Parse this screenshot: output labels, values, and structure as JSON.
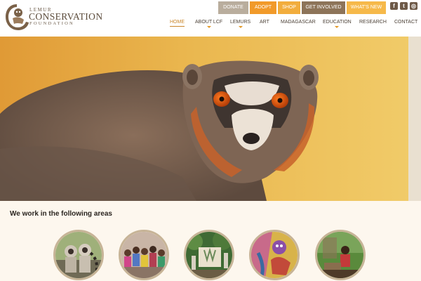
{
  "logo": {
    "line1": "LEMUR",
    "line2": "CONSERVATION",
    "line3": "FOUNDATION"
  },
  "top_buttons": [
    {
      "label": "DONATE",
      "color": "#b9ad9d"
    },
    {
      "label": "ADOPT",
      "color": "#f19a2a"
    },
    {
      "label": "SHOP",
      "color": "#f2ad3d"
    },
    {
      "label": "GET INVOLVED",
      "color": "#8d7459"
    },
    {
      "label": "WHAT'S NEW",
      "color": "#f6b94a"
    }
  ],
  "social": [
    {
      "icon": "facebook-icon",
      "glyph": "f"
    },
    {
      "icon": "twitter-icon",
      "glyph": "t"
    },
    {
      "icon": "instagram-icon",
      "glyph": "◎"
    }
  ],
  "nav": [
    {
      "label": "HOME",
      "active": true
    },
    {
      "label": "ABOUT LCF",
      "has_submenu": true
    },
    {
      "label": "LEMURS",
      "has_submenu": true
    },
    {
      "label": "ART"
    },
    {
      "label": "MADAGASCAR"
    },
    {
      "label": "EDUCATION",
      "has_submenu": true
    },
    {
      "label": "RESEARCH"
    },
    {
      "label": "CONTACT"
    }
  ],
  "hero": {
    "subject": "mongoose-lemur-photo"
  },
  "areas": {
    "title": "We work in the following areas",
    "items": [
      {
        "icon": "ring-tailed-lemurs-photo"
      },
      {
        "icon": "community-group-photo"
      },
      {
        "icon": "forest-sign-photo"
      },
      {
        "icon": "lemur-artwork-photo"
      },
      {
        "icon": "researcher-photo"
      }
    ]
  },
  "colors": {
    "accent": "#f19a2a",
    "brown": "#8d7459",
    "nav_active": "#c9862a"
  }
}
